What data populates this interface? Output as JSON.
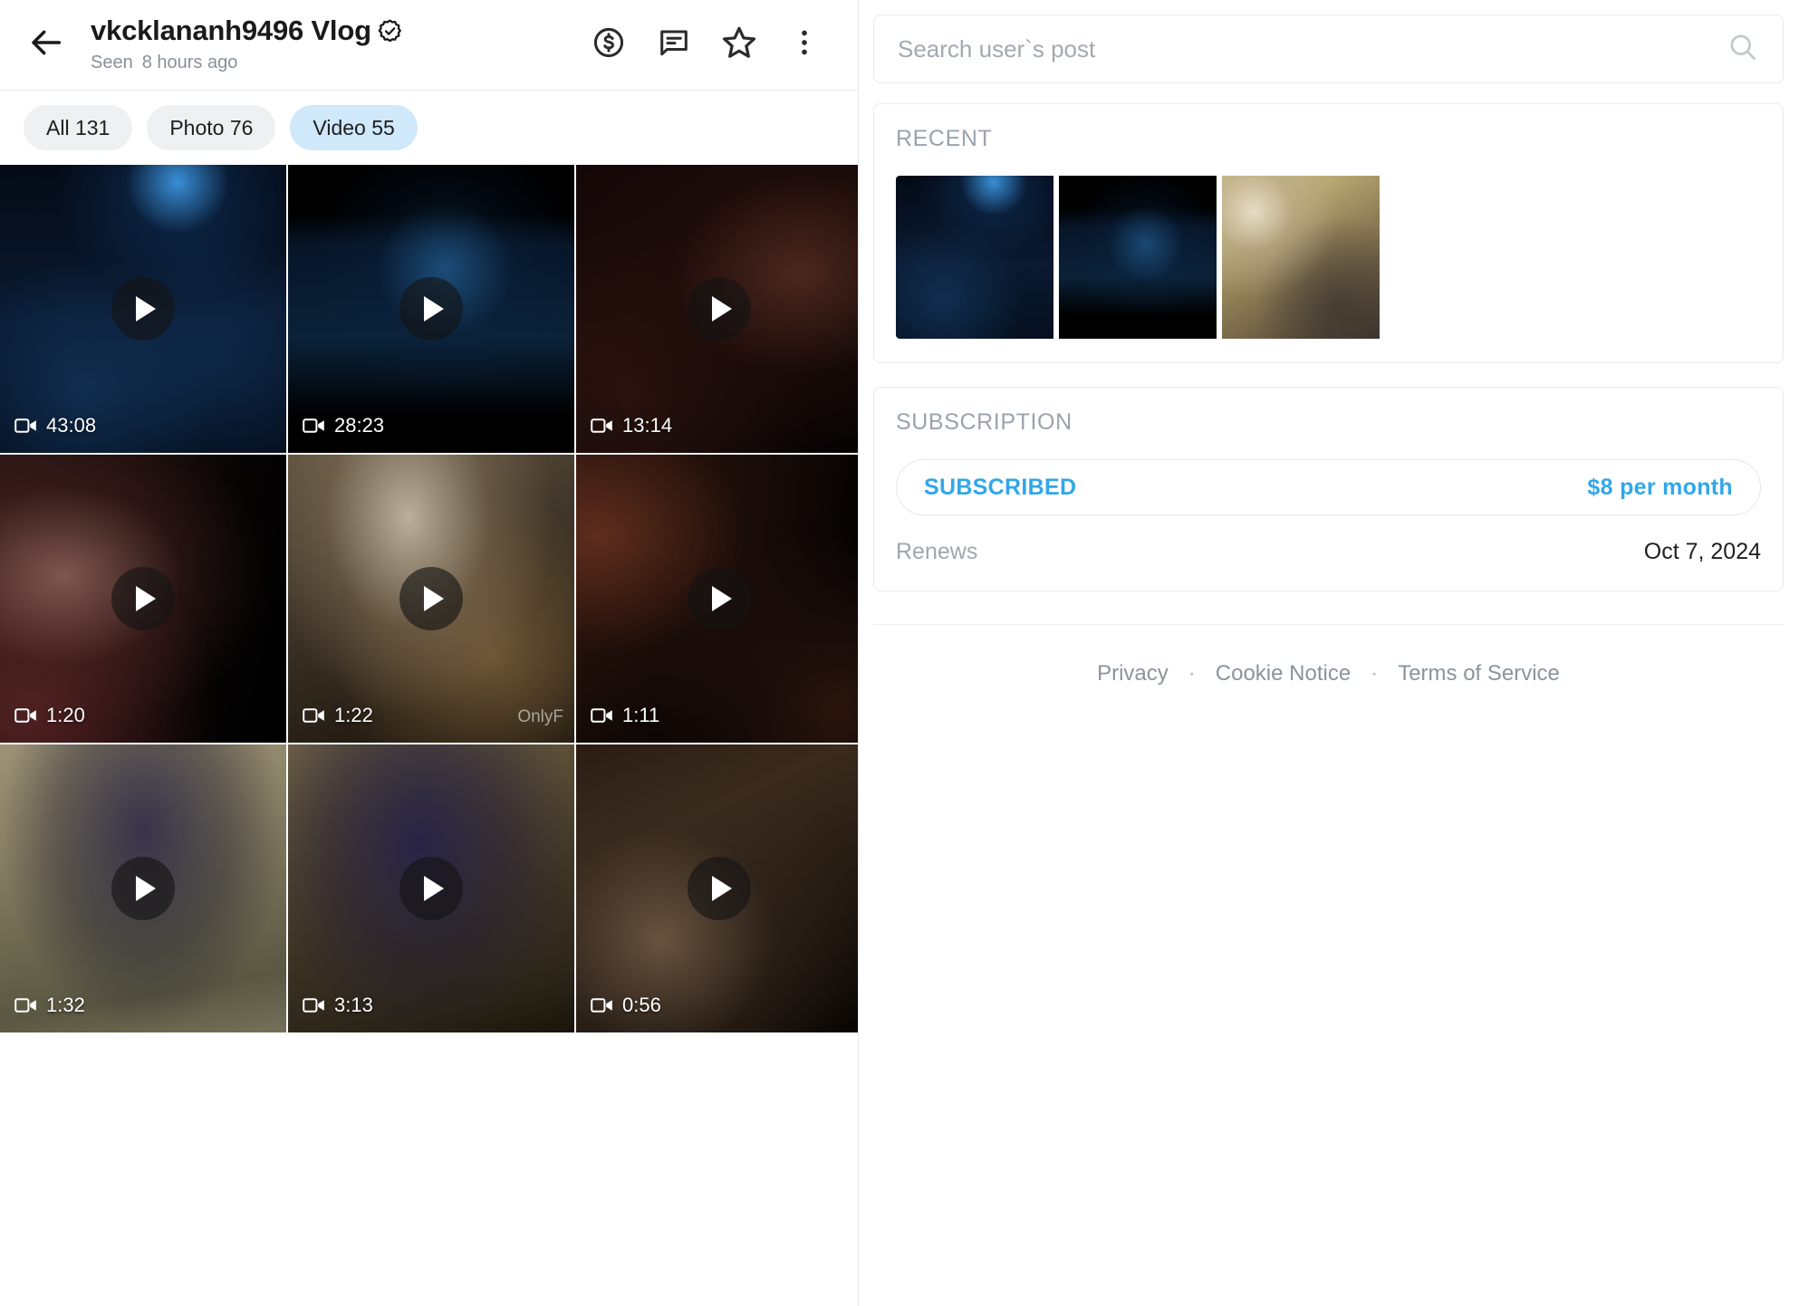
{
  "header": {
    "back_icon": "arrow-left-icon",
    "title": "vkcklananh9496 Vlog",
    "verified_icon": "verified-badge-icon",
    "seen_label": "Seen",
    "seen_time": "8 hours ago",
    "actions": [
      {
        "name": "tip-money-icon",
        "label": "$"
      },
      {
        "name": "message-icon",
        "label": ""
      },
      {
        "name": "star-favorite-icon",
        "label": ""
      },
      {
        "name": "more-options-icon",
        "label": ""
      }
    ]
  },
  "filters": [
    {
      "label": "All 131",
      "active": false
    },
    {
      "label": "Photo 76",
      "active": false
    },
    {
      "label": "Video 55",
      "active": true
    }
  ],
  "media_grid": {
    "items": [
      {
        "duration": "43:08",
        "tone": "night-blue"
      },
      {
        "duration": "28:23",
        "tone": "dark-blue-band"
      },
      {
        "duration": "13:14",
        "tone": "dark-maroon"
      },
      {
        "duration": "1:20",
        "tone": "dark-skin-red"
      },
      {
        "duration": "1:22",
        "tone": "warm-tan"
      },
      {
        "duration": "1:11",
        "tone": "dark-brown"
      },
      {
        "duration": "1:32",
        "tone": "olive-lace"
      },
      {
        "duration": "3:13",
        "tone": "tan-navy"
      },
      {
        "duration": "0:56",
        "tone": "dark-tan"
      }
    ],
    "play_icon": "play-icon",
    "camera_icon": "video-camera-icon",
    "watermark": "OnlyF"
  },
  "sidebar": {
    "search": {
      "placeholder": "Search user`s post",
      "value": "",
      "icon": "search-icon"
    },
    "recent": {
      "title": "RECENT",
      "thumbs": [
        {
          "tone": "night-blue"
        },
        {
          "tone": "dark-blue-band"
        },
        {
          "tone": "yellow-floor-photo"
        }
      ]
    },
    "subscription": {
      "title": "SUBSCRIPTION",
      "status": "SUBSCRIBED",
      "price": "$8 per month",
      "renew_label": "Renews",
      "renew_date": "Oct 7, 2024"
    },
    "footer": {
      "links": [
        "Privacy",
        "Cookie Notice",
        "Terms of Service"
      ],
      "separator": "·"
    }
  },
  "colors": {
    "accent": "#31a7e8",
    "chip_active_bg": "#cfe8fa",
    "chip_bg": "#eff0f1",
    "muted_text": "#9aa3ad"
  }
}
